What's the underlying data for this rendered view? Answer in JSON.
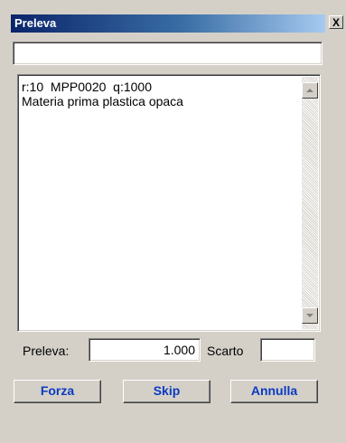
{
  "window": {
    "title": "Preleva",
    "close_label": "X"
  },
  "top_input": {
    "value": ""
  },
  "list": {
    "line1": "r:10  MPP0020  q:1000",
    "line2": "Materia prima plastica opaca"
  },
  "form": {
    "preleva_label": "Preleva:",
    "preleva_value": "1.000",
    "scarto_label": "Scarto",
    "scarto_value": ""
  },
  "buttons": {
    "forza": "Forza",
    "skip": "Skip",
    "annulla": "Annulla"
  },
  "colors": {
    "title_gradient_start": "#0a246a",
    "title_gradient_end": "#a6caf0",
    "button_text": "#0a3ac2",
    "window_bg": "#d4d0c8"
  }
}
